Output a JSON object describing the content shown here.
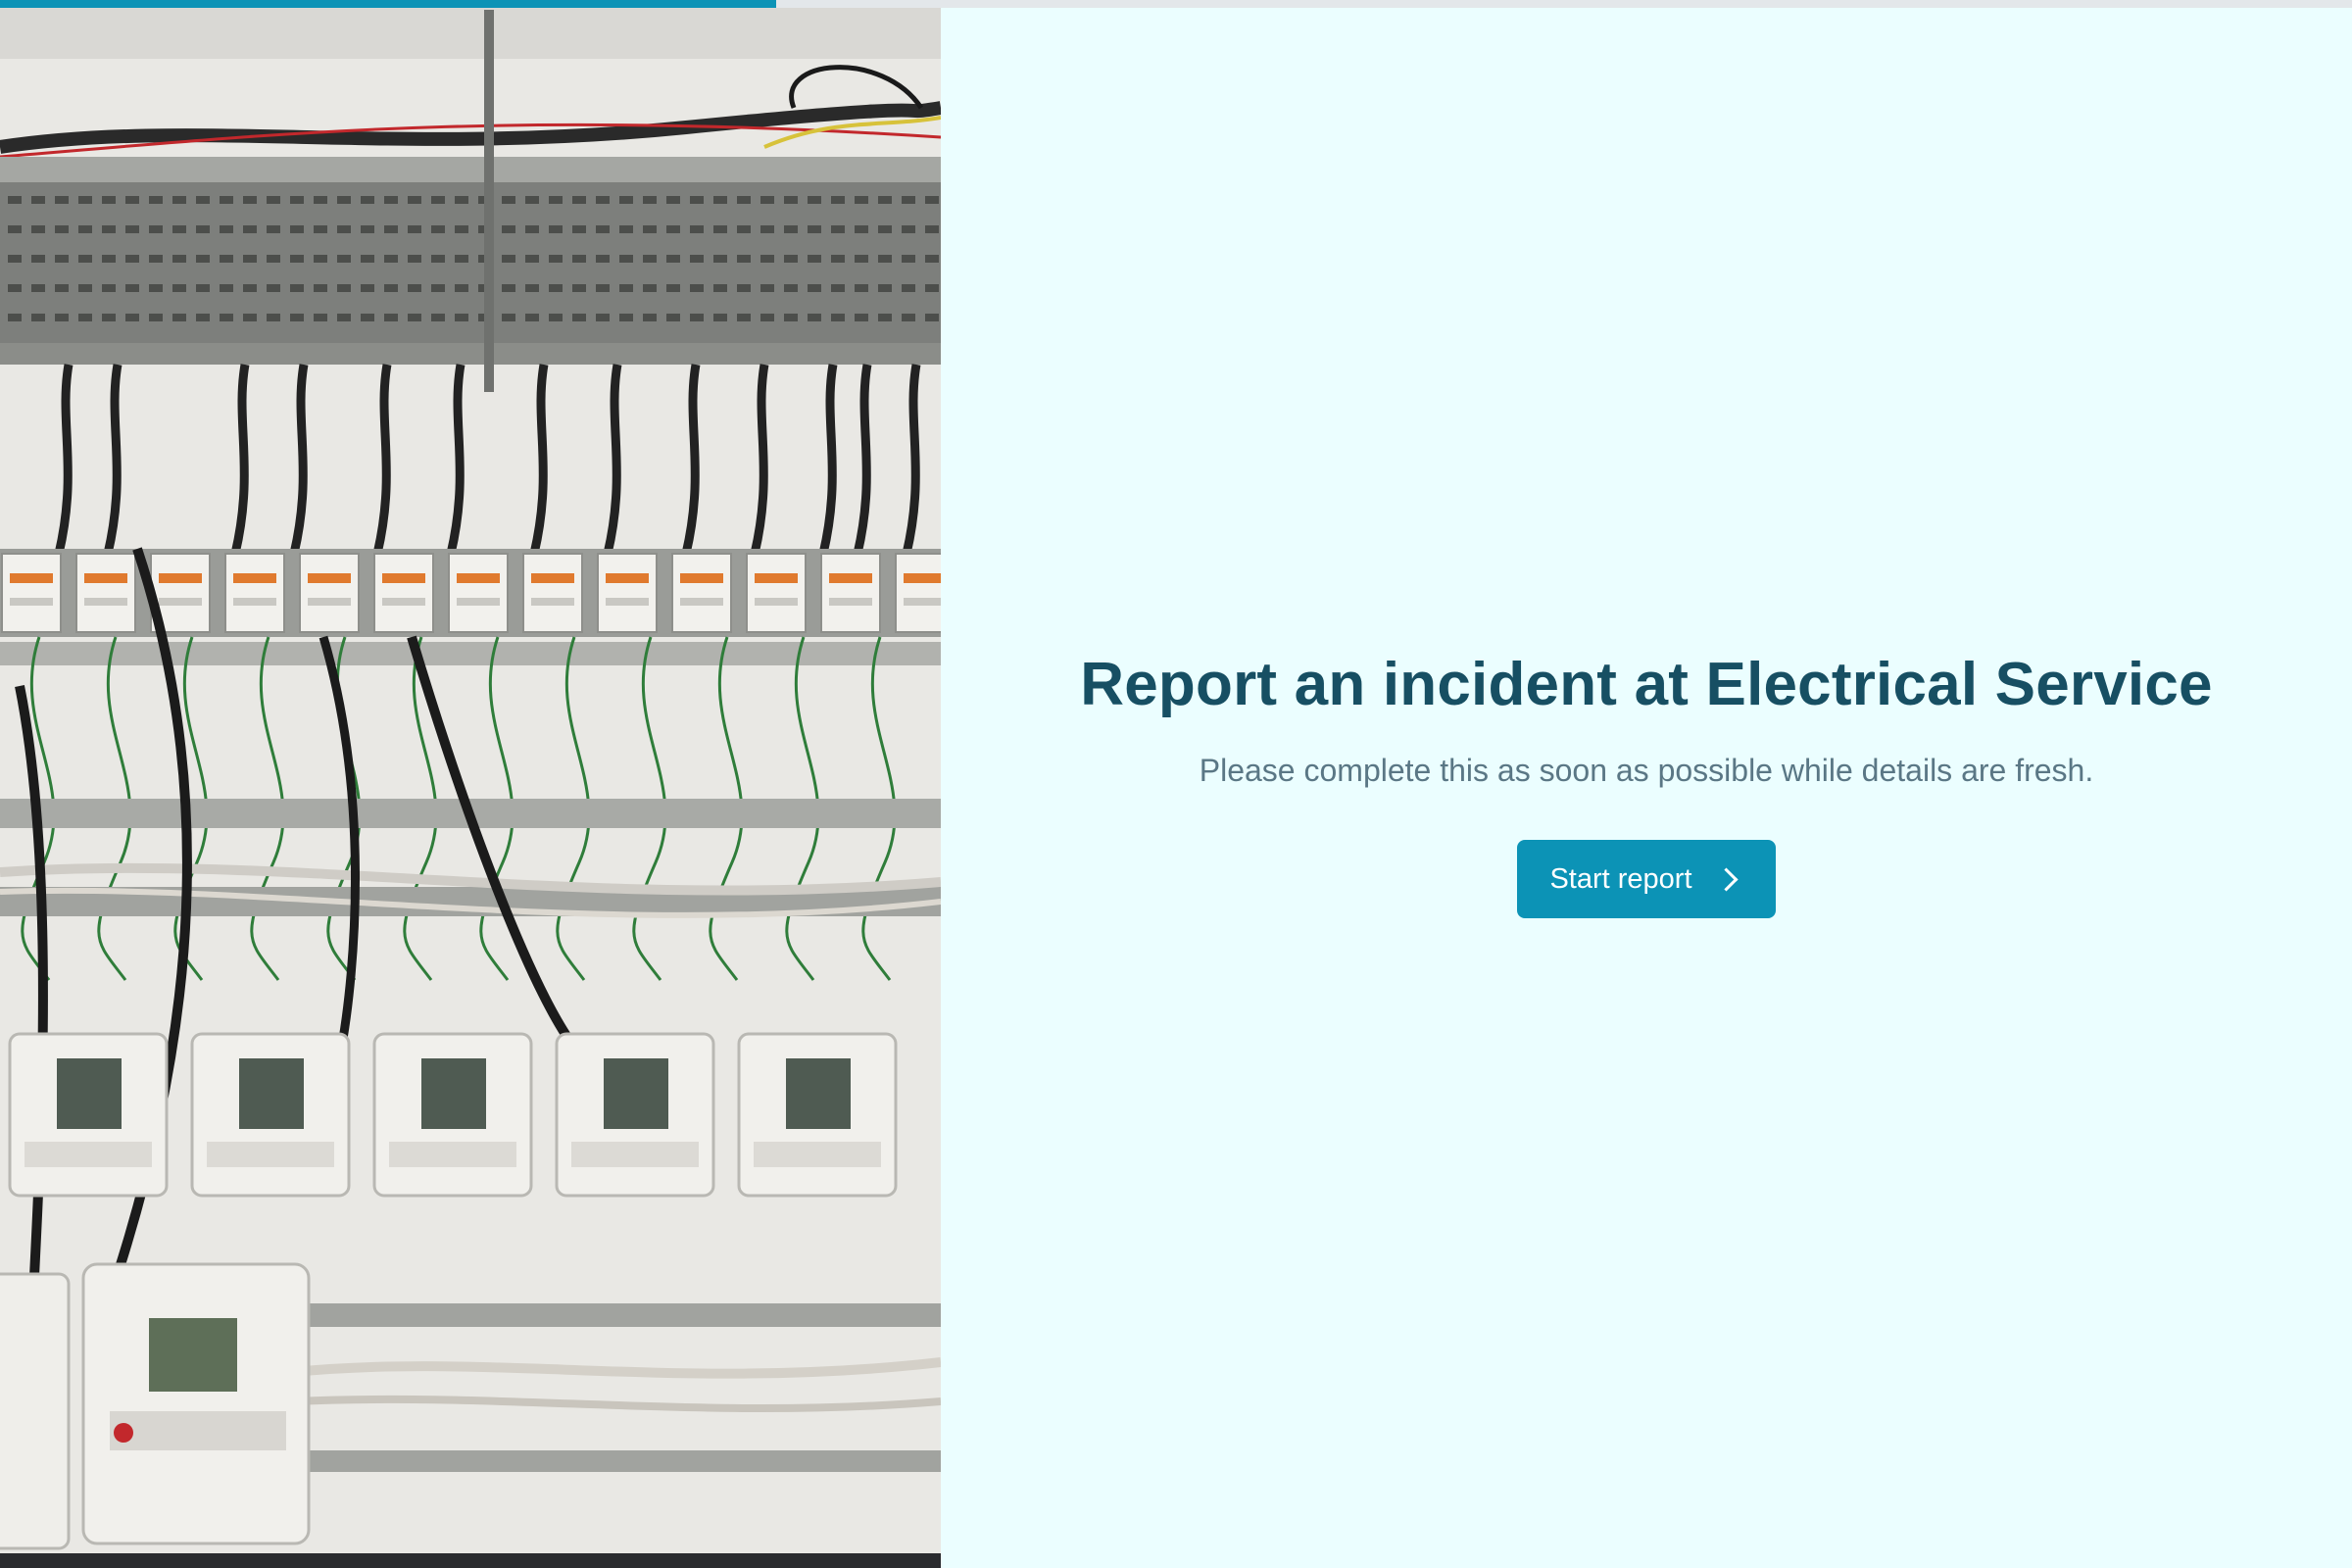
{
  "progress": {
    "fraction": 0.33,
    "color": "#0c93b6"
  },
  "hero_image": {
    "description_icon": "electrical-panel-photo"
  },
  "main": {
    "title": "Report an incident at Electrical Service",
    "subtitle": "Please complete this as soon as possible while details are fresh.",
    "start_button_label": "Start report",
    "start_button_icon": "chevron-right-icon"
  },
  "colors": {
    "background": "#ebfeff",
    "accent": "#0c93b6",
    "title": "#174f63",
    "subtitle": "#5a7785"
  }
}
